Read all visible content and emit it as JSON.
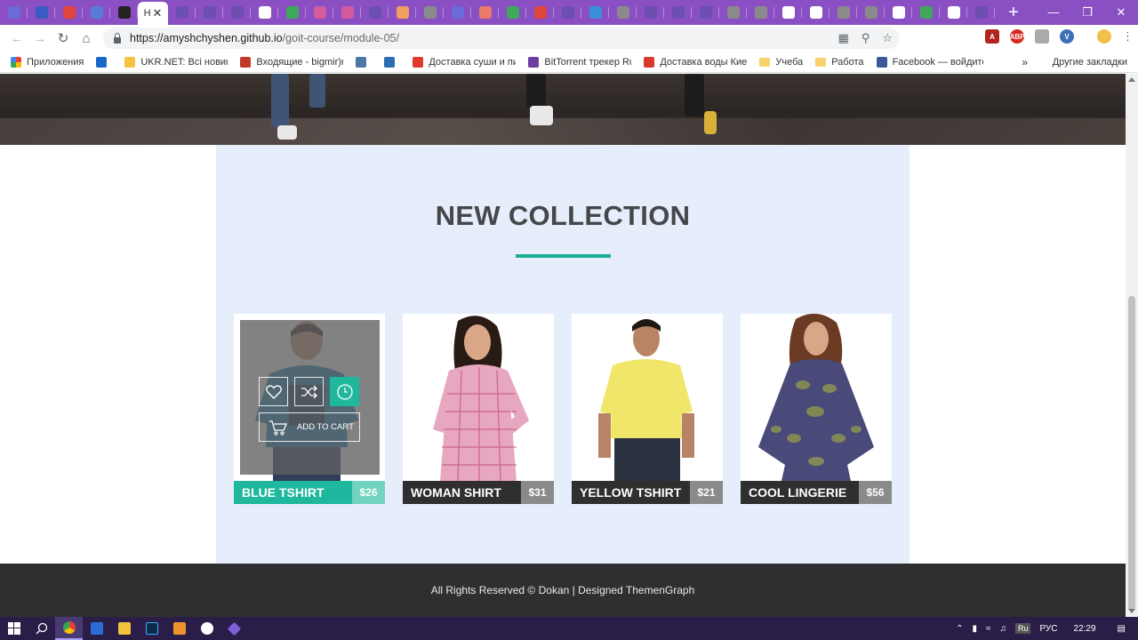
{
  "browser": {
    "url_host": "https://amyshchyshen.github.io",
    "url_path": "/goit-course/module-05/",
    "active_tab_title": "H",
    "tab_favicon_colors": [
      "#6a6ad8",
      "#3b5cc4",
      "#e0463c",
      "#5a7ad8",
      "#222",
      "#fff",
      "#6c4fb0",
      "#6c4fb0",
      "#6c4fb0",
      "#fff",
      "#3fa85a",
      "#d45ba0",
      "#d45ba0",
      "#6c4fb0",
      "#f0a060",
      "#8a8a8a",
      "#6a6ad8",
      "#e87a6a",
      "#3fa85a",
      "#e0463c",
      "#6c4fb0",
      "#3b8ed8",
      "#8a8a8a",
      "#6c4fb0",
      "#6c4fb0",
      "#6c4fb0",
      "#8a8a8a",
      "#8a8a8a",
      "#fff",
      "#fff",
      "#8a8a8a",
      "#8a8a8a",
      "#fff",
      "#3fa85a",
      "#fff",
      "#6c4fb0"
    ]
  },
  "bookmarks": {
    "apps": "Приложения",
    "items": [
      {
        "label": "",
        "color": "#1b66c9"
      },
      {
        "label": "UKR.NET: Всі новини",
        "color": "#f5c242"
      },
      {
        "label": "Входящие - bigmir)net",
        "color": "#c0392b"
      },
      {
        "label": "",
        "color": "#4a76a8"
      },
      {
        "label": "",
        "color": "#2b6cb0"
      },
      {
        "label": "Доставка суши и пиццы",
        "color": "#e03a2e"
      },
      {
        "label": "BitTorrent трекер RuTracker",
        "color": "#6a3fa0"
      },
      {
        "label": "Доставка воды Киев",
        "color": "#d63a2a"
      }
    ],
    "folders": [
      "Учеба",
      "Работа"
    ],
    "facebook": "Facebook — войдите",
    "more": "»",
    "other": "Другие закладки"
  },
  "page": {
    "section_title": "NEW COLLECTION",
    "products": [
      {
        "name": "BLUE TSHIRT",
        "price": "$26"
      },
      {
        "name": "WOMAN SHIRT",
        "price": "$31"
      },
      {
        "name": "YELLOW TSHIRT",
        "price": "$21"
      },
      {
        "name": "COOL LINGERIE",
        "price": "$56"
      }
    ],
    "add_to_cart": "ADD TO CART",
    "footer": "All Rights Reserved © Dokan | Designed ThemenGraph"
  },
  "colors": {
    "accent": "#1fb89e",
    "section_bg": "#e6eefb",
    "footer_bg": "#2f2f2f",
    "title": "#45474a"
  },
  "taskbar": {
    "lang_badge": "Ru",
    "lang": "РУС",
    "time": "22:29"
  }
}
